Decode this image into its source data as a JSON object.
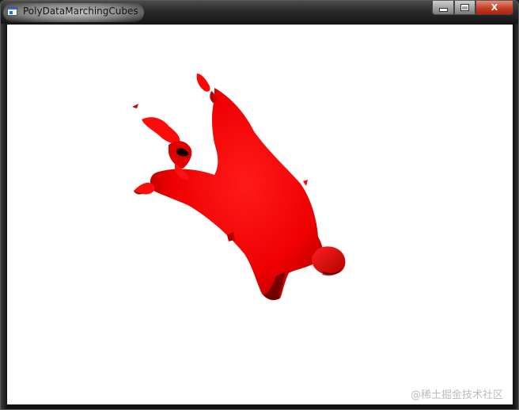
{
  "window": {
    "title": "PolyDataMarchingCubes",
    "app_icon": "vtk-window-icon",
    "buttons": {
      "minimize_icon": "minimize-icon",
      "maximize_icon": "maximize-icon",
      "close_icon": "close-icon",
      "close_label": "X"
    }
  },
  "viewport": {
    "background": "#ffffff",
    "surface_color": "#ff0000",
    "shadow_color": "#000000"
  },
  "watermark": "@稀土掘金技术社区"
}
